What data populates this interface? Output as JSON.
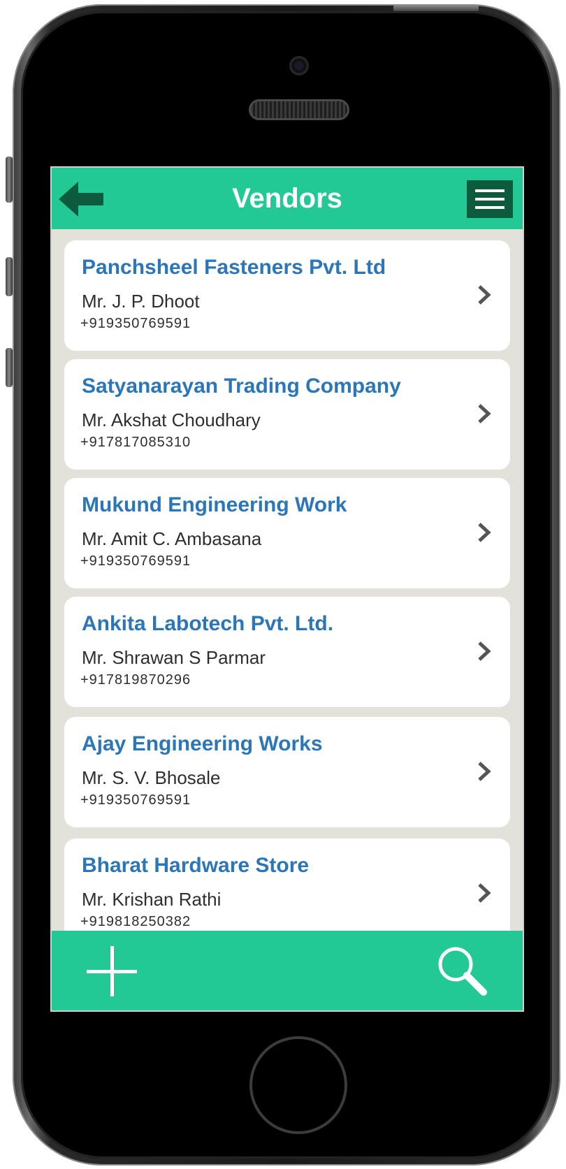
{
  "header": {
    "title": "Vendors",
    "back_icon": "arrow-left-icon",
    "menu_icon": "hamburger-menu-icon"
  },
  "vendors": [
    {
      "name": "Panchsheel Fasteners Pvt. Ltd",
      "contact": "Mr. J. P. Dhoot",
      "phone": "+919350769591"
    },
    {
      "name": "Satyanarayan Trading Company",
      "contact": "Mr. Akshat Choudhary",
      "phone": "+917817085310"
    },
    {
      "name": "Mukund Engineering Work",
      "contact": "Mr. Amit C. Ambasana",
      "phone": "+919350769591"
    },
    {
      "name": "Ankita Labotech Pvt. Ltd.",
      "contact": "Mr. Shrawan S Parmar",
      "phone": "+917819870296"
    },
    {
      "name": "Ajay Engineering Works",
      "contact": "Mr. S. V. Bhosale",
      "phone": "+919350769591"
    },
    {
      "name": "Bharat Hardware Store",
      "contact": "Mr. Krishan Rathi",
      "phone": "+919818250382"
    }
  ],
  "footer": {
    "add_icon": "plus-icon",
    "search_icon": "search-icon"
  },
  "colors": {
    "accent": "#22c995",
    "dark_accent": "#0c5b3f",
    "vendor_name": "#2b76b9",
    "list_background": "#e2e1da"
  }
}
